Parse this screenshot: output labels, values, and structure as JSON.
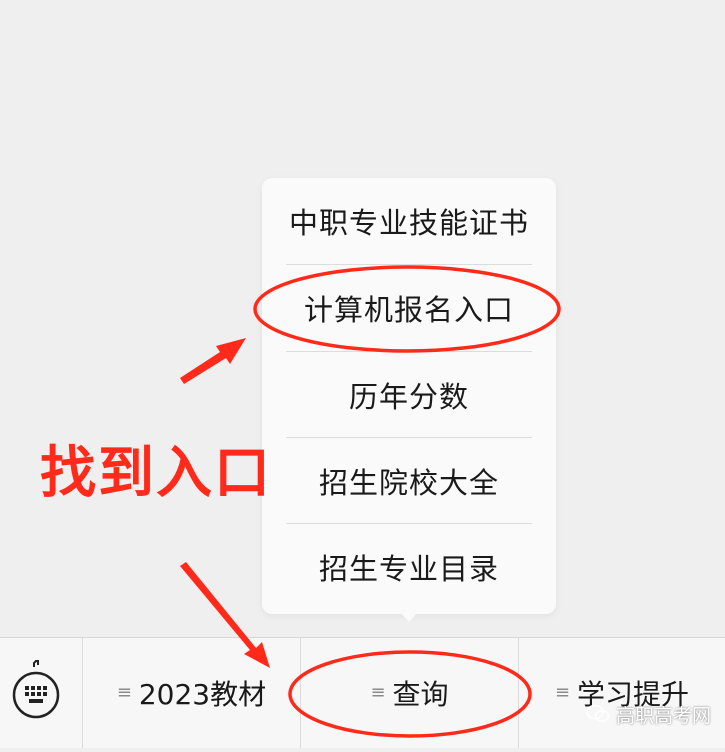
{
  "menu": {
    "items": [
      {
        "label": "中职专业技能证书"
      },
      {
        "label": "计算机报名入口"
      },
      {
        "label": "历年分数"
      },
      {
        "label": "招生院校大全"
      },
      {
        "label": "招生专业目录"
      }
    ]
  },
  "bottom_bar": {
    "keyboard_icon": "keyboard-icon",
    "buttons": [
      {
        "label": "2023教材",
        "icon": "menu-lines-icon"
      },
      {
        "label": "查询",
        "icon": "menu-lines-icon"
      },
      {
        "label": "学习提升",
        "icon": "menu-lines-icon"
      }
    ]
  },
  "annotation": {
    "text": "找到入口",
    "color": "#ff2a1a"
  },
  "watermark": {
    "text": "高职高考网",
    "icon": "wechat-logo-icon"
  },
  "colors": {
    "background": "#efefef",
    "popup": "#fafafa",
    "bar": "#f7f7f7",
    "annotation_red": "#ff2a1a"
  }
}
